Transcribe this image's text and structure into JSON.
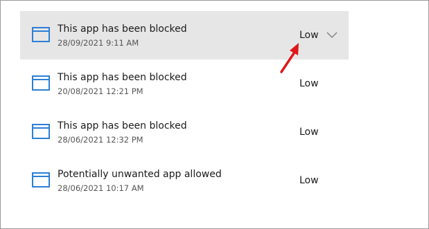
{
  "threat_history": {
    "items": [
      {
        "icon": "app-window-icon",
        "title": "This app has been blocked",
        "timestamp": "28/09/2021 9:11 AM",
        "severity": "Low",
        "selected": true
      },
      {
        "icon": "app-window-icon",
        "title": "This app has been blocked",
        "timestamp": "20/08/2021 12:21 PM",
        "severity": "Low",
        "selected": false
      },
      {
        "icon": "app-window-icon",
        "title": "This app has been blocked",
        "timestamp": "28/06/2021 12:32 PM",
        "severity": "Low",
        "selected": false
      },
      {
        "icon": "app-window-icon",
        "title": "Potentially unwanted app allowed",
        "timestamp": "28/06/2021 10:17 AM",
        "severity": "Low",
        "selected": false
      }
    ]
  },
  "annotation": {
    "arrow_icon": "red-pointer-arrow-icon",
    "arrow_color": "#e0161b"
  },
  "colors": {
    "icon_blue": "#2b7fd6",
    "selected_background": "#e6e6e6"
  }
}
